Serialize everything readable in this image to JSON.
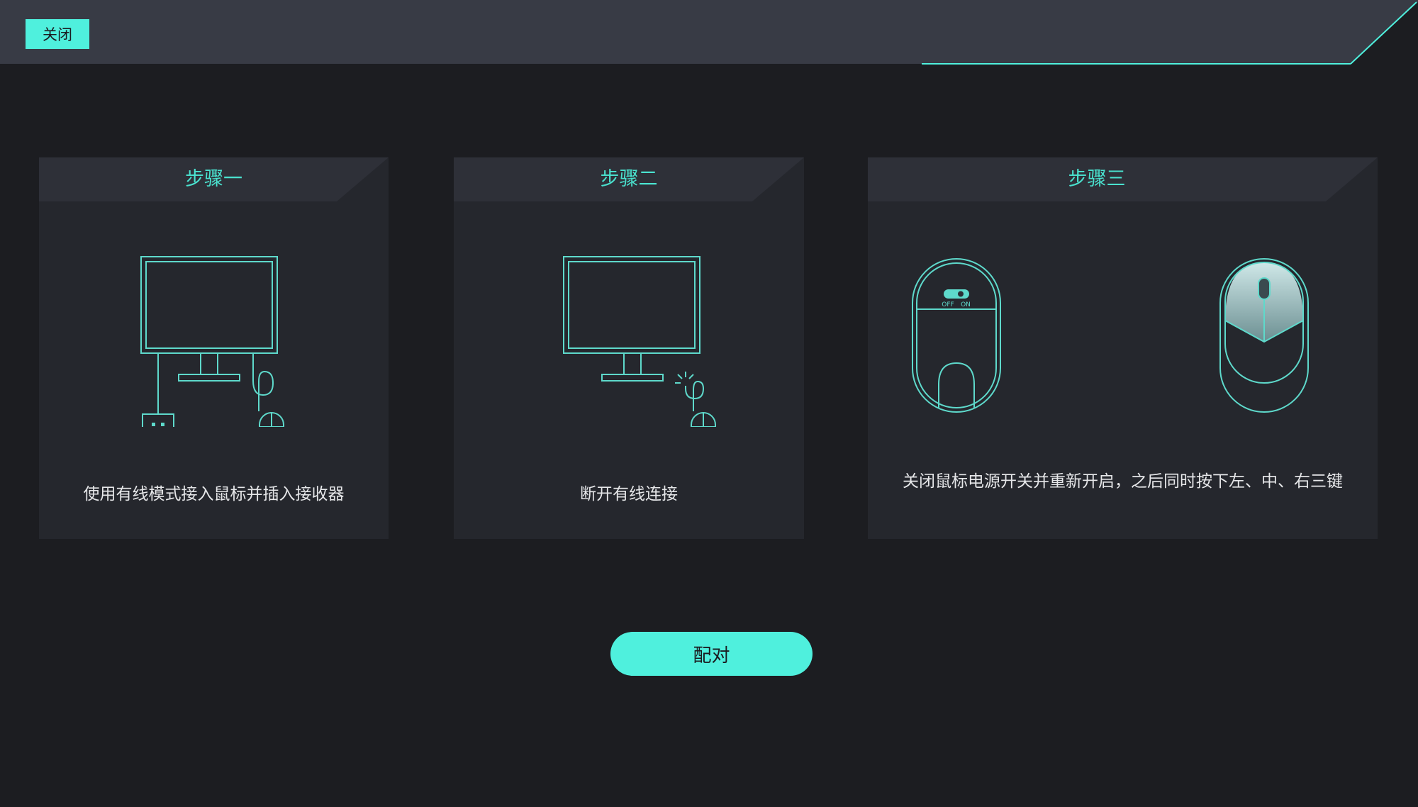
{
  "header": {
    "close_label": "关闭"
  },
  "steps": [
    {
      "title": "步骤一",
      "description": "使用有线模式接入鼠标并插入接收器"
    },
    {
      "title": "步骤二",
      "description": "断开有线连接"
    },
    {
      "title": "步骤三",
      "description": "关闭鼠标电源开关并重新开启，之后同时按下左、中、右三键",
      "switch_off": "OFF",
      "switch_on": "ON"
    }
  ],
  "footer": {
    "pair_label": "配对"
  },
  "colors": {
    "accent": "#4ff0dd",
    "background": "#1c1d21",
    "card": "#25272d",
    "card_header": "#2e3038",
    "line": "#5ed9cb"
  }
}
